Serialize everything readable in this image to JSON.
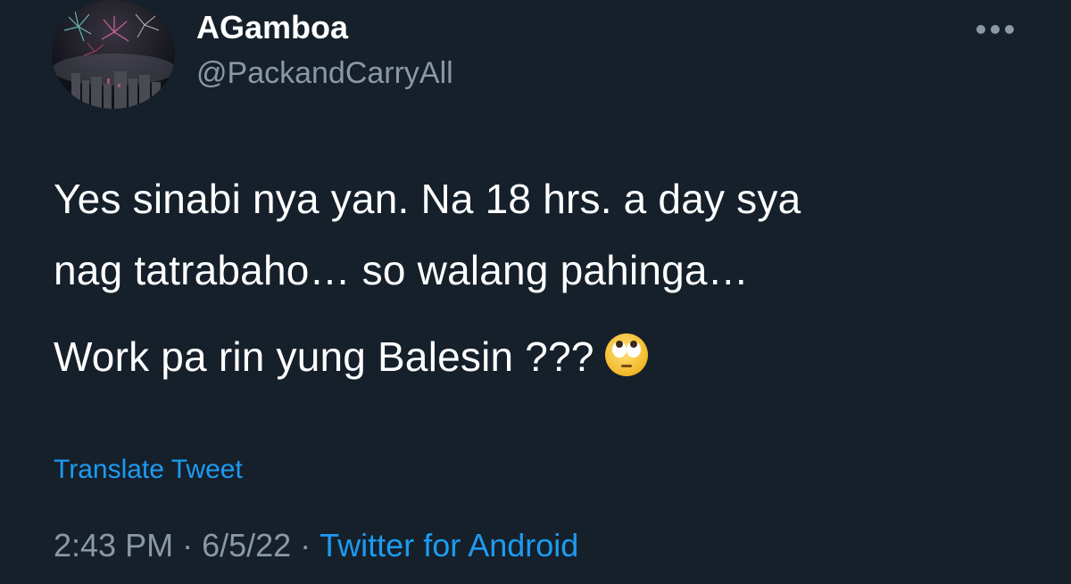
{
  "tweet": {
    "display_name": "AGamboa",
    "handle": "@PackandCarryAll",
    "text_lines": [
      "Yes sinabi nya yan. Na 18 hrs. a day sya",
      "nag tatrabaho… so walang pahinga…",
      "Work pa rin yung Balesin ???"
    ],
    "emoji": "face-with-rolling-eyes-icon",
    "translate_label": "Translate Tweet",
    "time": "2:43 PM",
    "separator": "·",
    "date": "6/5/22",
    "source": "Twitter for Android"
  },
  "colors": {
    "background": "#15202b",
    "text_primary": "#ffffff",
    "text_secondary": "#8b98a5",
    "link": "#1d9bf0"
  }
}
